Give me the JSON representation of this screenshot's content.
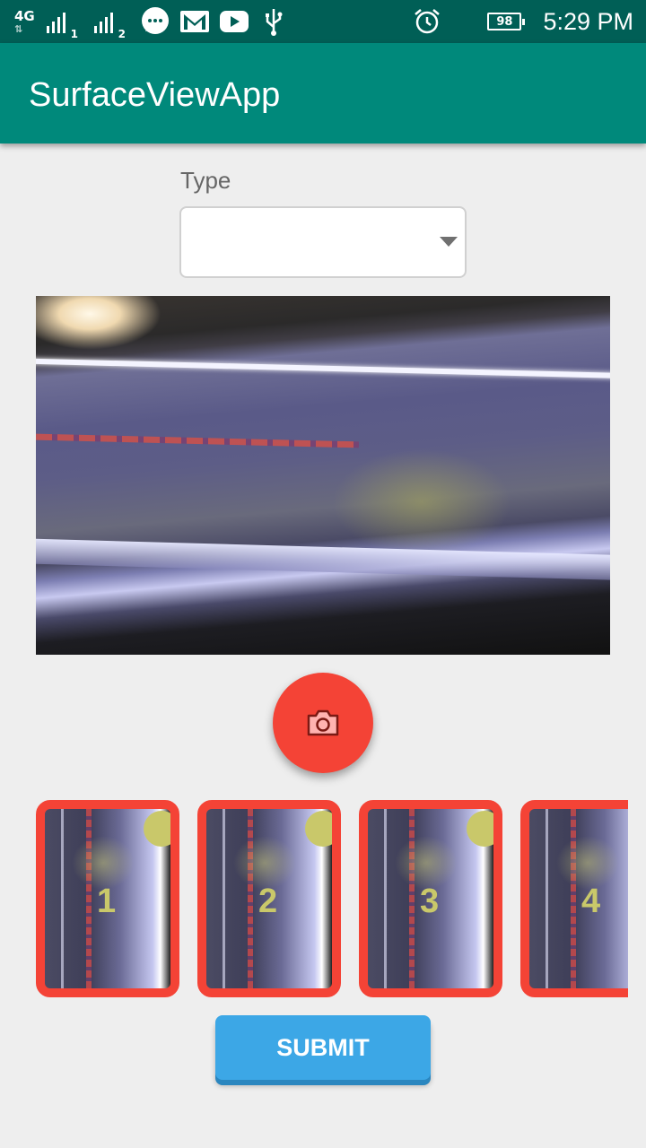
{
  "status_bar": {
    "network": "4G",
    "sim1": "1",
    "sim2": "2",
    "icons": [
      "network-4g-icon",
      "signal-sim1-icon",
      "signal-sim2-icon",
      "messages-icon",
      "gmail-icon",
      "youtube-icon",
      "usb-icon",
      "alarm-icon",
      "battery-icon"
    ],
    "battery": "98",
    "time": "5:29 PM",
    "bg_color": "#005f56"
  },
  "app_bar": {
    "title": "SurfaceViewApp",
    "color": "#00897b"
  },
  "form": {
    "type_label": "Type",
    "type_value": ""
  },
  "capture_button": {
    "icon": "camera-icon",
    "color": "#f44336"
  },
  "thumbnails": [
    {
      "number": "1"
    },
    {
      "number": "2"
    },
    {
      "number": "3"
    },
    {
      "number": "4"
    }
  ],
  "submit": {
    "label": "SUBMIT",
    "color": "#3ca7e6"
  }
}
